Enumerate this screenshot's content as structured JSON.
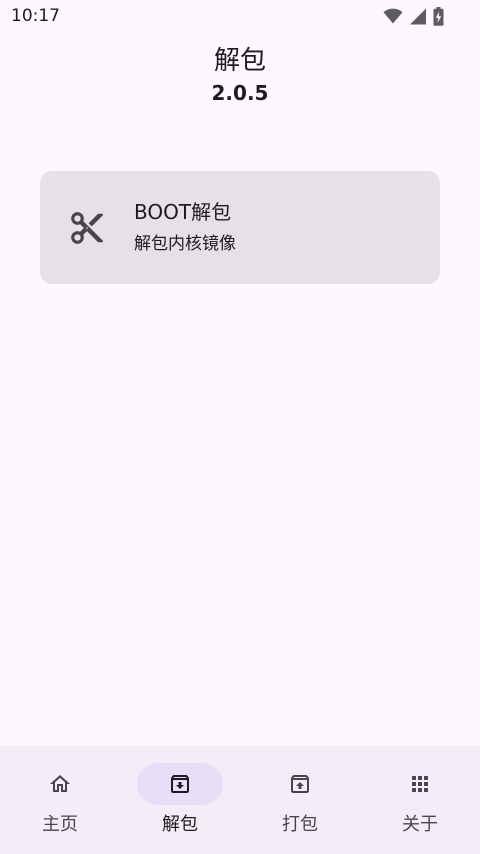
{
  "status_bar": {
    "time": "10:17"
  },
  "header": {
    "title": "解包",
    "version": "2.0.5"
  },
  "card": {
    "title": "BOOT解包",
    "subtitle": "解包内核镜像",
    "icon": "scissors-icon"
  },
  "bottom_nav": {
    "items": [
      {
        "label": "主页",
        "icon": "home-icon",
        "active": false
      },
      {
        "label": "解包",
        "icon": "archive-download-icon",
        "active": true
      },
      {
        "label": "打包",
        "icon": "archive-upload-icon",
        "active": false
      },
      {
        "label": "关于",
        "icon": "apps-grid-icon",
        "active": false
      }
    ]
  },
  "colors": {
    "background": "#fdf8fd",
    "card": "#e6e0e9",
    "nav_background": "#f3edf7",
    "active_indicator": "#e8def8",
    "text": "#1d1b20"
  }
}
